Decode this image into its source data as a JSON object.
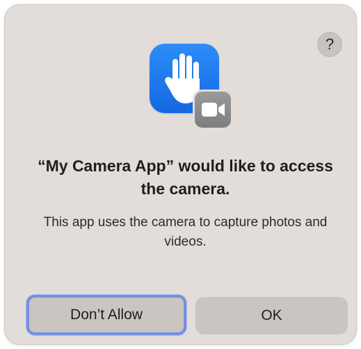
{
  "dialog": {
    "help_label": "?",
    "title": "“My Camera App” would like to access the camera.",
    "message": "This app uses the camera to capture photos and videos.",
    "icons": {
      "app": "raised-hand-privacy-icon",
      "badge": "video-camera-icon",
      "help": "question-mark-icon"
    },
    "buttons": {
      "deny_label": "Don’t Allow",
      "allow_label": "OK"
    }
  },
  "colors": {
    "dialog_background": "#e3ddd9",
    "app_icon_blue": "#1f7bef",
    "focus_ring": "#7590e0",
    "button_background": "#cbc5c1"
  }
}
